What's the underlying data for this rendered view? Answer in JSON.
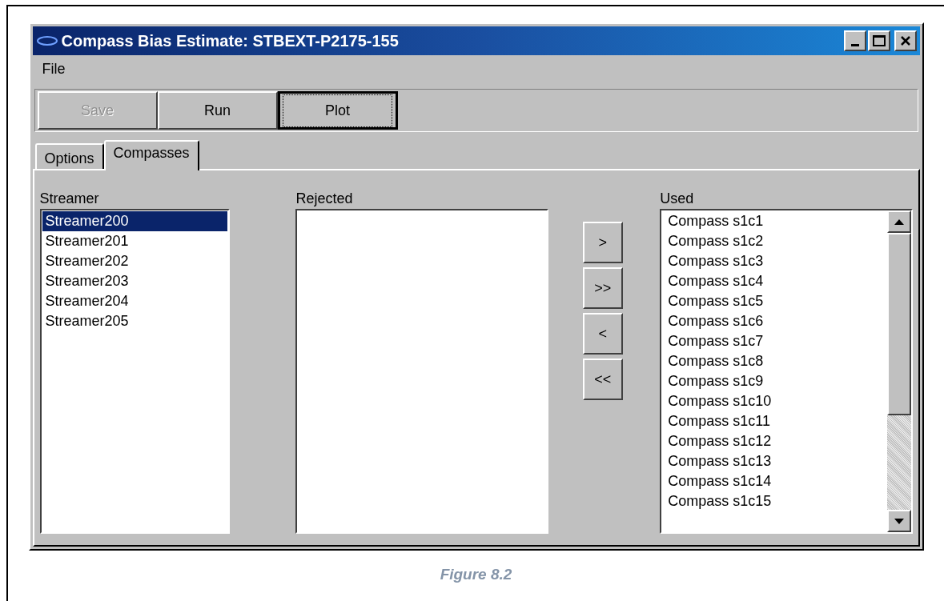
{
  "window": {
    "title": "Compass Bias Estimate: STBEXT-P2175-155"
  },
  "menu": [
    {
      "label": "File"
    }
  ],
  "toolbar": [
    {
      "label": "Save",
      "disabled": true,
      "focused": false
    },
    {
      "label": "Run",
      "disabled": false,
      "focused": false
    },
    {
      "label": "Plot",
      "disabled": false,
      "focused": true
    }
  ],
  "tabs": [
    {
      "label": "Options",
      "selected": false
    },
    {
      "label": "Compasses",
      "selected": true
    }
  ],
  "streamer": {
    "label": "Streamer",
    "items": [
      {
        "text": "Streamer200",
        "selected": true
      },
      {
        "text": "Streamer201",
        "selected": false
      },
      {
        "text": "Streamer202",
        "selected": false
      },
      {
        "text": "Streamer203",
        "selected": false
      },
      {
        "text": "Streamer204",
        "selected": false
      },
      {
        "text": "Streamer205",
        "selected": false
      }
    ]
  },
  "rejected": {
    "label": "Rejected"
  },
  "move_buttons": [
    ">",
    ">>",
    "<",
    "<<"
  ],
  "used": {
    "label": "Used",
    "items": [
      {
        "text": "Compass s1c1",
        "selected": false
      },
      {
        "text": "Compass s1c2",
        "selected": false
      },
      {
        "text": "Compass s1c3",
        "selected": false
      },
      {
        "text": "Compass s1c4",
        "selected": false
      },
      {
        "text": "Compass s1c5",
        "selected": false
      },
      {
        "text": "Compass s1c6",
        "selected": false
      },
      {
        "text": "Compass s1c7",
        "selected": false
      },
      {
        "text": "Compass s1c8",
        "selected": false
      },
      {
        "text": "Compass s1c9",
        "selected": false
      },
      {
        "text": "Compass s1c10",
        "selected": false
      },
      {
        "text": "Compass s1c11",
        "selected": false
      },
      {
        "text": "Compass s1c12",
        "selected": false
      },
      {
        "text": "Compass s1c13",
        "selected": false
      },
      {
        "text": "Compass s1c14",
        "selected": false
      },
      {
        "text": "Compass s1c15",
        "selected": false
      }
    ]
  },
  "caption": "Figure 8.2"
}
